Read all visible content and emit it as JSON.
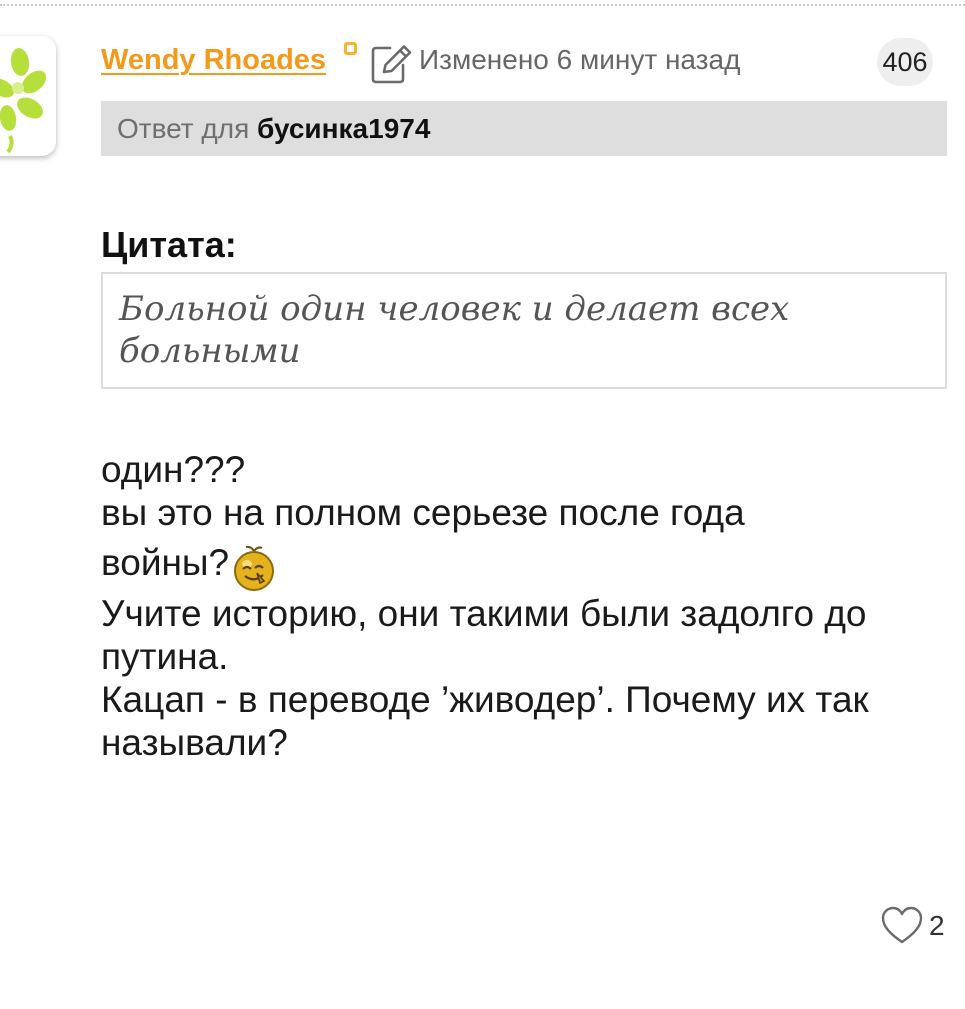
{
  "post": {
    "author": "Wendy Rhoades",
    "edited": "Изменено 6 минут назад",
    "number": "406",
    "reply": {
      "prefix": "Ответ для",
      "user": "бусинка1974"
    },
    "quote": {
      "title": "Цитата:",
      "text": "Больной один человек и делает всех больными"
    },
    "body": {
      "line1": "один???",
      "line2": "вы это на полном серьезе после года",
      "line3": "войны?",
      "line4": "Учите историю, они такими были задолго до путина.",
      "line5": "Кацап - в переводе ’живодер’. Почему их так называли?"
    },
    "likes": "2"
  },
  "icons": {
    "avatar": "lime-avatar",
    "status": "status-square-icon",
    "edit": "edit-icon",
    "smiley": "smiley-icon",
    "like": "heart-icon"
  },
  "colors": {
    "author": "#f39a1a",
    "reply_bar": "#dedede",
    "quote_text": "#555555"
  }
}
